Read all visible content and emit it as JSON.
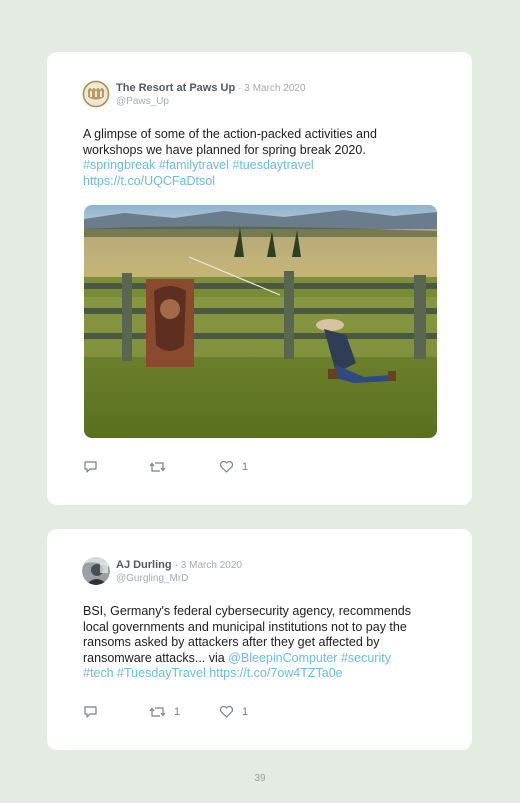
{
  "tweets": [
    {
      "author": "The Resort at Paws Up",
      "date": "· 3 March 2020",
      "handle": "@Paws_Up",
      "text_lines": [
        "A glimpse of some of the action-packed activities and",
        "workshops we have planned for spring break 2020."
      ],
      "hashtags": "#springbreak #familytravel #tuesdaytravel",
      "url": "https://t.co/UQCFaDtsol",
      "avatar_icon": "resort-logo-icon",
      "replies": "",
      "retweets": "",
      "likes": "1"
    },
    {
      "author": "AJ Durling",
      "date": "· 3 March 2020",
      "handle": "@Gurgling_MrD",
      "line1": "BSI, Germany's federal cybersecurity agency, recommends",
      "line2": "local governments and municipal institutions not to pay the",
      "line3": "ransoms asked by attackers after they get affected by",
      "line4_text": "ransomware attacks... via ",
      "line4_link": "@BleepinComputer #security",
      "line5_link": "#tech #TuesdayTravel",
      "line5_text": " https://t.co/7ow4TZTa0e",
      "replies": "",
      "retweets": "1",
      "likes": "1"
    }
  ],
  "page_number": "39",
  "colors": {
    "background": "#e3ebe2",
    "card": "#ffffff",
    "link": "#6bbde3",
    "meta": "#a7acaf"
  }
}
